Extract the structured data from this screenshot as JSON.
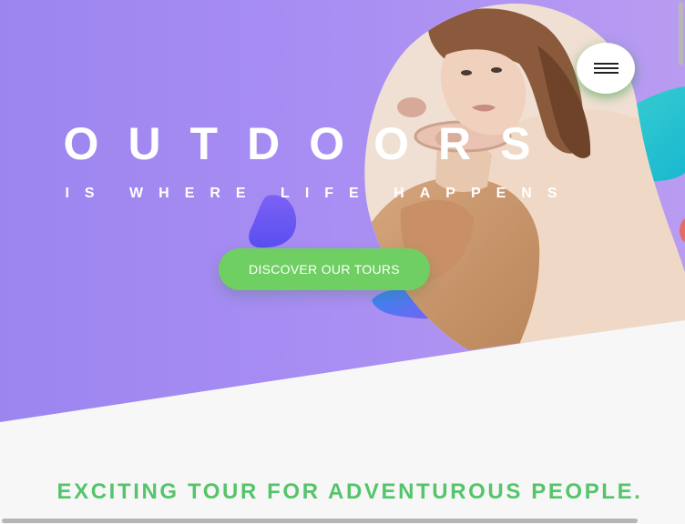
{
  "hero": {
    "title": "OUTDOORS",
    "subtitle": "IS WHERE LIFE HAPPENS",
    "cta_label": "DISCOVER OUR TOURS"
  },
  "nav": {
    "menu_icon": "hamburger-menu-icon"
  },
  "section": {
    "heading": "EXCITING TOUR FOR ADVENTUROUS PEOPLE."
  },
  "colors": {
    "hero_gradient_start": "#9d86f0",
    "hero_gradient_end": "#b69af2",
    "accent_green": "#6fcf62",
    "heading_green": "#55c46b",
    "background": "#f7f7f7"
  }
}
